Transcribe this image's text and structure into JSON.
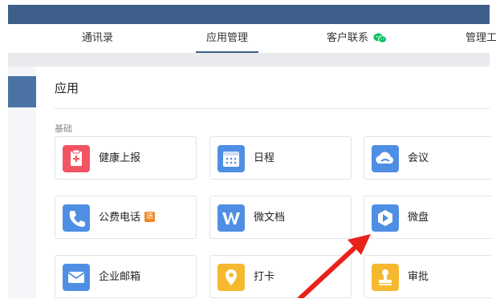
{
  "nav": {
    "tabs": [
      {
        "label": "通讯录"
      },
      {
        "label": "应用管理"
      },
      {
        "label": "客户联系"
      },
      {
        "label": "管理工"
      }
    ],
    "active_tab": "应用管理"
  },
  "page": {
    "title": "应用"
  },
  "sections": [
    {
      "label": "基础",
      "apps": [
        {
          "label": "健康上报",
          "icon": "health-report-icon",
          "color": "#f25463"
        },
        {
          "label": "日程",
          "icon": "calendar-icon",
          "color": "#4f8fe3"
        },
        {
          "label": "会议",
          "icon": "cloud-meeting-icon",
          "color": "#4f8fe3"
        },
        {
          "label": "公费电话",
          "icon": "phone-icon",
          "color": "#4f8fe3",
          "badge": "送"
        },
        {
          "label": "微文档",
          "icon": "document-w-icon",
          "color": "#4f8fe3"
        },
        {
          "label": "微盘",
          "icon": "drive-icon",
          "color": "#4f8fe3"
        },
        {
          "label": "企业邮箱",
          "icon": "mail-icon",
          "color": "#4f8fe3"
        },
        {
          "label": "打卡",
          "icon": "location-pin-icon",
          "color": "#f5b82e"
        },
        {
          "label": "审批",
          "icon": "stamp-icon",
          "color": "#f5b82e"
        }
      ]
    }
  ],
  "annotation": {
    "arrow_color": "#e8221b"
  }
}
